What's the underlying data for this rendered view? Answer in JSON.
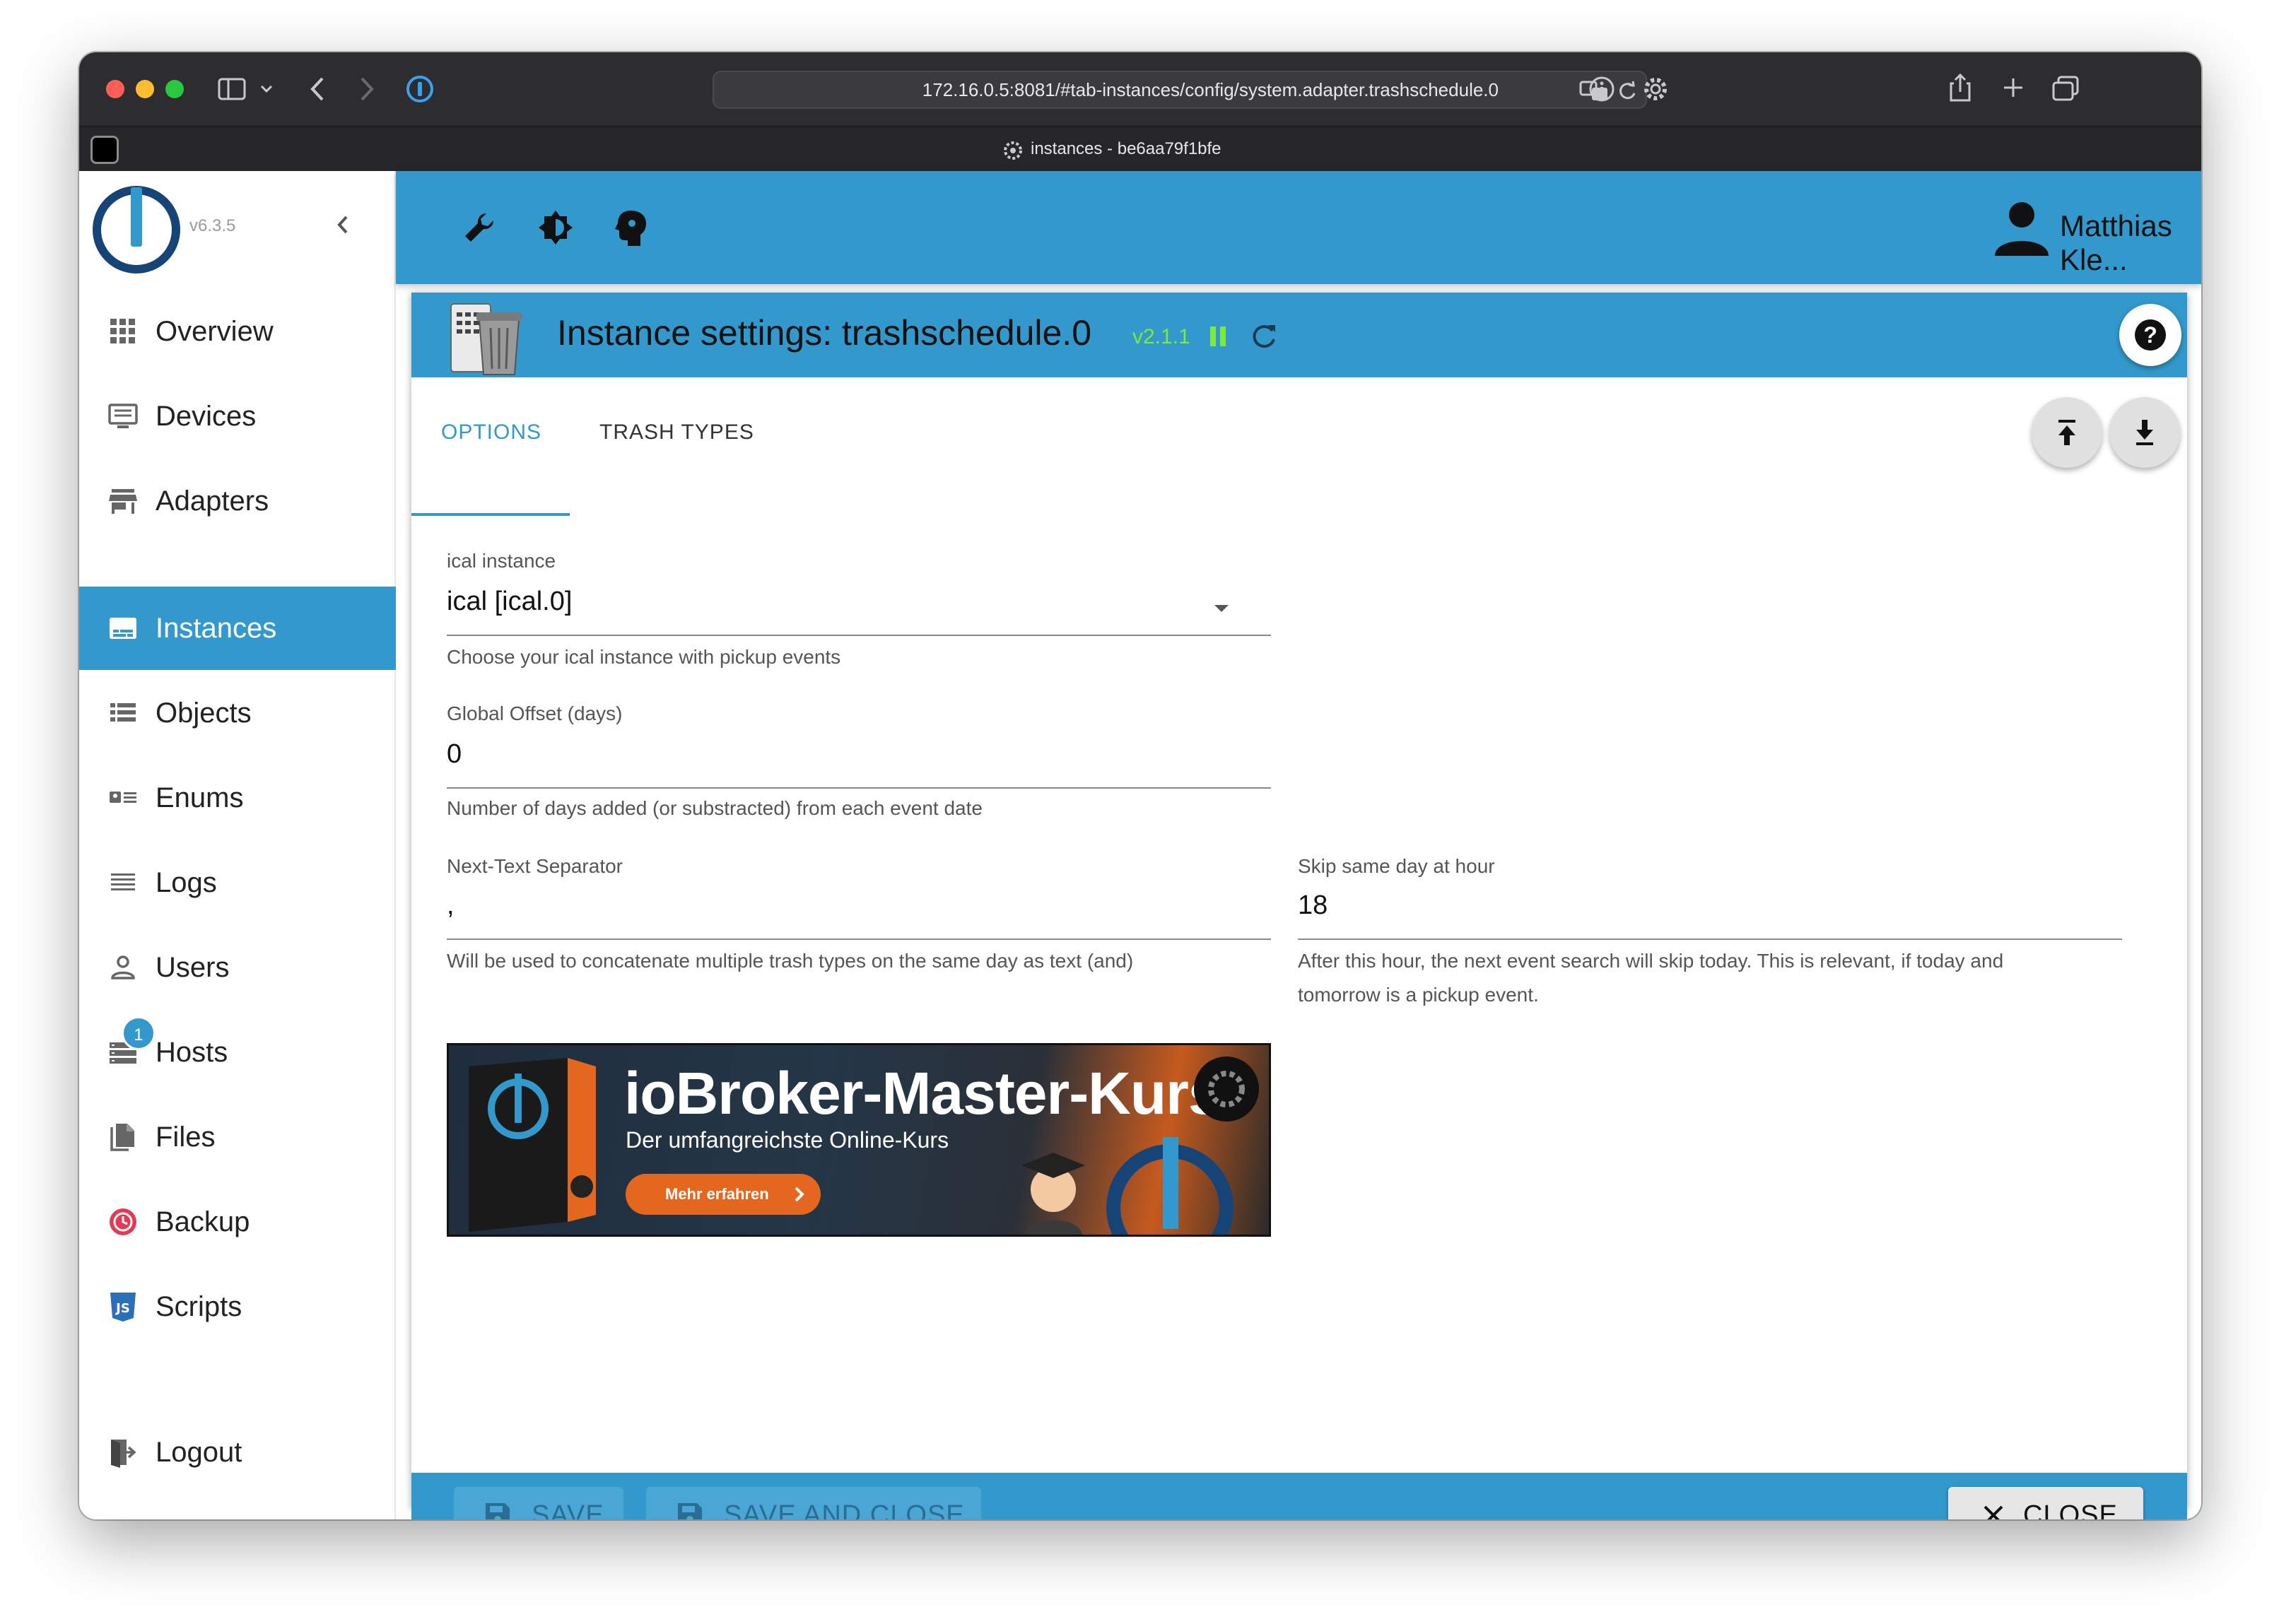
{
  "browser": {
    "url": "172.16.0.5:8081/#tab-instances/config/system.adapter.trashschedule.0",
    "tab_title": "instances - be6aa79f1bfe"
  },
  "app": {
    "version": "v6.3.5",
    "user_name": "Matthias Kle...",
    "accent_color": "#3399cc"
  },
  "sidebar": {
    "items": [
      {
        "label": "Overview",
        "icon": "grid-icon"
      },
      {
        "label": "Devices",
        "icon": "devices-icon"
      },
      {
        "label": "Adapters",
        "icon": "store-icon"
      },
      {
        "label": "Instances",
        "icon": "instances-icon"
      },
      {
        "label": "Objects",
        "icon": "list-icon"
      },
      {
        "label": "Enums",
        "icon": "enum-icon"
      },
      {
        "label": "Logs",
        "icon": "lines-icon"
      },
      {
        "label": "Users",
        "icon": "user-icon"
      },
      {
        "label": "Hosts",
        "icon": "hosts-icon",
        "badge": "1"
      },
      {
        "label": "Files",
        "icon": "files-icon"
      },
      {
        "label": "Backup",
        "icon": "backup-icon"
      },
      {
        "label": "Scripts",
        "icon": "js-icon"
      }
    ],
    "logout": "Logout"
  },
  "dialog": {
    "title": "Instance settings: trashschedule.0",
    "version": "v2.1.1",
    "tabs": [
      "OPTIONS",
      "TRASH TYPES"
    ],
    "fields": {
      "ical": {
        "label": "ical instance",
        "value": "ical [ical.0]",
        "help": "Choose your ical instance with pickup events"
      },
      "offset": {
        "label": "Global Offset (days)",
        "value": "0",
        "help": "Number of days added (or substracted) from each event date"
      },
      "separator": {
        "label": "Next-Text Separator",
        "value": ",",
        "help": "Will be used to concatenate multiple trash types on the same day as text (and)"
      },
      "skip_hour": {
        "label": "Skip same day at hour",
        "value": "18",
        "help_line1": "After this hour, the next event search will skip today. This is relevant, if today and",
        "help_line2": "tomorrow is a pickup event."
      }
    },
    "banner": {
      "title": "ioBroker-Master-Kurs",
      "subtitle": "Der umfangreichste Online-Kurs",
      "button": "Mehr erfahren"
    },
    "footer": {
      "save": "SAVE",
      "save_close": "SAVE AND CLOSE",
      "close": "CLOSE"
    }
  }
}
